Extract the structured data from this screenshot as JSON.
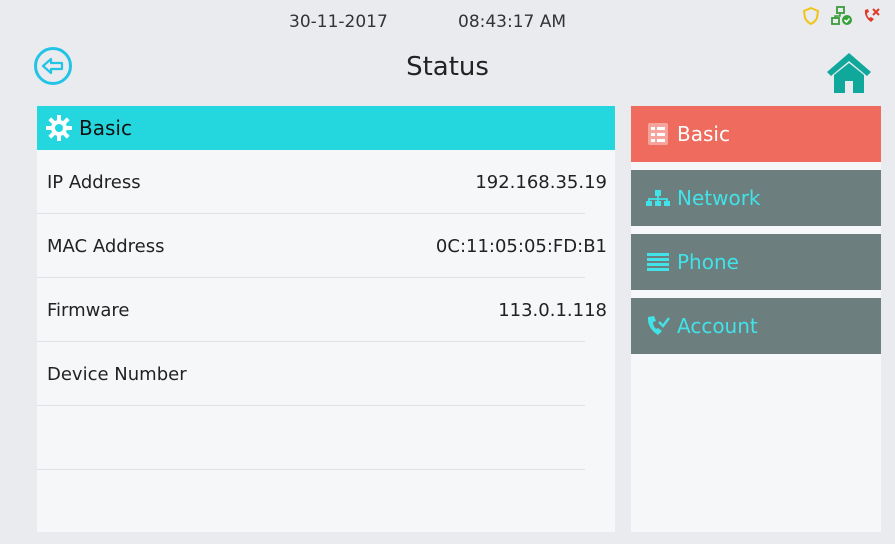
{
  "statusbar": {
    "date": "30-11-2017",
    "time": "08:43:17 AM"
  },
  "header": {
    "title": "Status"
  },
  "section": {
    "title": "Basic"
  },
  "rows": [
    {
      "label": "IP Address",
      "value": "192.168.35.19"
    },
    {
      "label": "MAC Address",
      "value": "0C:11:05:05:FD:B1"
    },
    {
      "label": "Firmware",
      "value": "113.0.1.118"
    },
    {
      "label": "Device Number",
      "value": ""
    }
  ],
  "menu": [
    {
      "label": "Basic",
      "icon": "document-list-icon",
      "active": true
    },
    {
      "label": "Network",
      "icon": "network-icon",
      "active": false
    },
    {
      "label": "Phone",
      "icon": "list-lines-icon",
      "active": false
    },
    {
      "label": "Account",
      "icon": "phone-account-icon",
      "active": false
    }
  ],
  "colors": {
    "accent": "#24d7de",
    "active_tab": "#ee6b5d",
    "inactive_tab": "#6d7e7e",
    "home": "#0fa89a"
  }
}
